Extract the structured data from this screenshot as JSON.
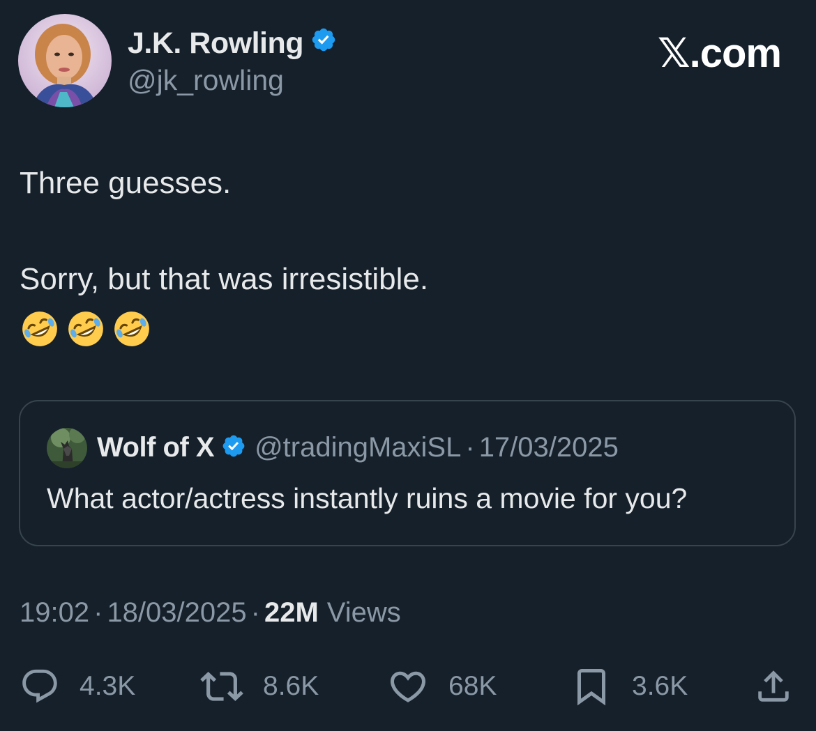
{
  "author": {
    "name": "J.K. Rowling",
    "handle": "@jk_rowling",
    "verified": true,
    "avatar_icon": "profile-photo-avatar"
  },
  "brand": "𝕏.com",
  "tweet": {
    "line1": "Three guesses.",
    "line2": "Sorry, but that was irresistible.",
    "emoji": [
      "rolling-on-floor-laughing",
      "rolling-on-floor-laughing",
      "rolling-on-floor-laughing"
    ]
  },
  "quote": {
    "name": "Wolf of X",
    "handle": "@tradingMaxiSL",
    "separator": "·",
    "date": "17/03/2025",
    "text": "What actor/actress instantly ruins a movie for you?",
    "avatar_icon": "wolf-avatar"
  },
  "meta": {
    "time": "19:02",
    "separator": "·",
    "date": "18/03/2025",
    "views_count": "22M",
    "views_label": "Views"
  },
  "actions": {
    "replies": "4.3K",
    "reposts": "8.6K",
    "likes": "68K",
    "bookmarks": "3.6K"
  },
  "colors": {
    "background": "#15202b",
    "text": "#e7e9ea",
    "secondary": "#8b98a5",
    "verified": "#1d9bf0",
    "border": "#38444d"
  }
}
